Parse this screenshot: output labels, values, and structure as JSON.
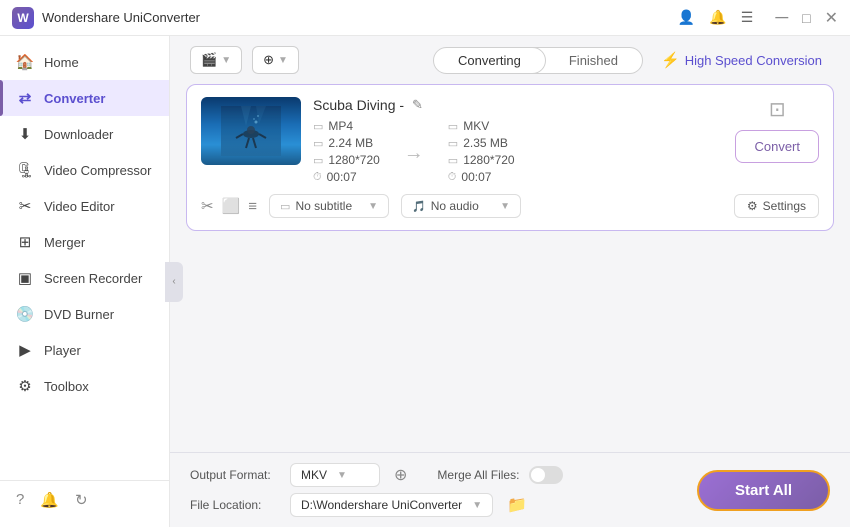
{
  "app": {
    "title": "Wondershare UniConverter",
    "logo_text": "W"
  },
  "titlebar": {
    "icons": [
      "user-icon",
      "bell-icon",
      "menu-icon"
    ],
    "win_buttons": [
      "minimize-button",
      "maximize-button",
      "close-button"
    ]
  },
  "sidebar": {
    "items": [
      {
        "id": "home",
        "label": "Home",
        "icon": "🏠"
      },
      {
        "id": "converter",
        "label": "Converter",
        "icon": "↔",
        "active": true
      },
      {
        "id": "downloader",
        "label": "Downloader",
        "icon": "⬇"
      },
      {
        "id": "video-compressor",
        "label": "Video Compressor",
        "icon": "🗜"
      },
      {
        "id": "video-editor",
        "label": "Video Editor",
        "icon": "✂"
      },
      {
        "id": "merger",
        "label": "Merger",
        "icon": "⊞"
      },
      {
        "id": "screen-recorder",
        "label": "Screen Recorder",
        "icon": "⬛"
      },
      {
        "id": "dvd-burner",
        "label": "DVD Burner",
        "icon": "💿"
      },
      {
        "id": "player",
        "label": "Player",
        "icon": "▶"
      },
      {
        "id": "toolbox",
        "label": "Toolbox",
        "icon": "⚙"
      }
    ],
    "footer_icons": [
      "question-icon",
      "bell-icon",
      "refresh-icon"
    ]
  },
  "toolbar": {
    "add_file_label": "▼",
    "add_dvd_label": "▼",
    "tabs": [
      {
        "id": "converting",
        "label": "Converting",
        "active": true
      },
      {
        "id": "finished",
        "label": "Finished",
        "active": false
      }
    ],
    "high_speed_label": "High Speed Conversion"
  },
  "file_card": {
    "filename": "Scuba Diving -",
    "source": {
      "format": "MP4",
      "size": "2.24 MB",
      "resolution": "1280*720",
      "duration": "00:07"
    },
    "target": {
      "format": "MKV",
      "size": "2.35 MB",
      "resolution": "1280*720",
      "duration": "00:07"
    },
    "subtitle_label": "No subtitle",
    "audio_label": "No audio",
    "settings_label": "Settings",
    "convert_btn_label": "Convert"
  },
  "bottom_bar": {
    "output_format_label": "Output Format:",
    "output_format_value": "MKV",
    "merge_files_label": "Merge All Files:",
    "file_location_label": "File Location:",
    "file_location_path": "D:\\Wondershare UniConverter",
    "start_all_label": "Start All"
  }
}
